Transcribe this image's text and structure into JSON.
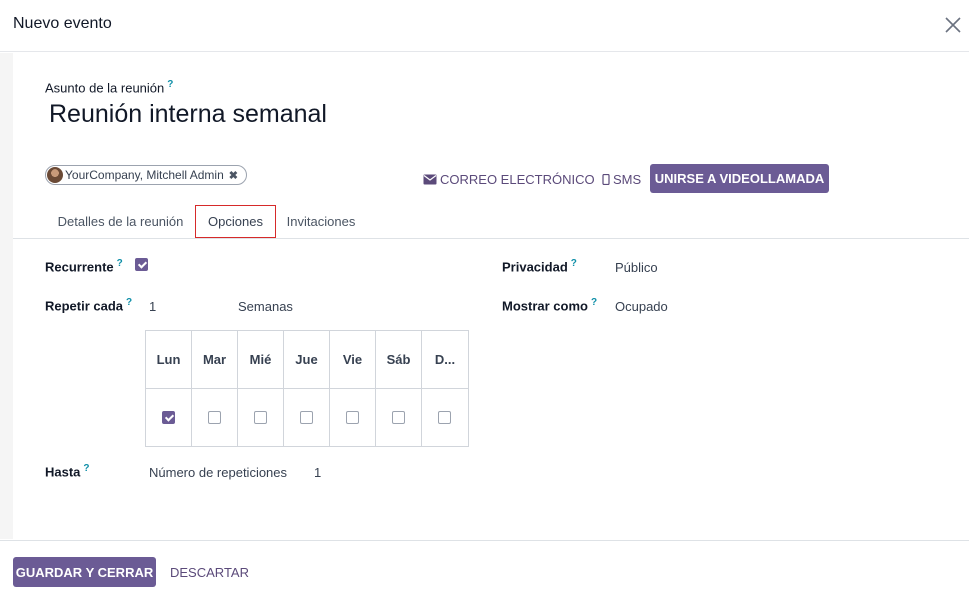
{
  "modal": {
    "title": "Nuevo evento",
    "close_icon": "close-icon"
  },
  "form": {
    "subject_label": "Asunto de la reunión",
    "help_mark": "?",
    "subject_value": "Reunión interna semanal",
    "attendee": {
      "name": "YourCompany, Mitchell Admin",
      "remove_glyph": "✖"
    }
  },
  "actions": {
    "email_label": "CORREO ELECTRÓNICO",
    "email_icon": "envelope-icon",
    "sms_label": "SMS",
    "sms_icon": "mobile-icon",
    "video_label": "UNIRSE A VIDEOLLAMADA"
  },
  "tabs": [
    {
      "label": "Detalles de la reunión",
      "active": false
    },
    {
      "label": "Opciones",
      "active": true
    },
    {
      "label": "Invitaciones",
      "active": false
    }
  ],
  "options": {
    "recurrent_label": "Recurrente",
    "recurrent_checked": true,
    "repeat_label": "Repetir cada",
    "repeat_value": "1",
    "repeat_unit": "Semanas",
    "days": [
      {
        "label": "Lun",
        "checked": true
      },
      {
        "label": "Mar",
        "checked": false
      },
      {
        "label": "Mié",
        "checked": false
      },
      {
        "label": "Jue",
        "checked": false
      },
      {
        "label": "Vie",
        "checked": false
      },
      {
        "label": "Sáb",
        "checked": false
      },
      {
        "label": "D...",
        "checked": false
      }
    ],
    "until_label": "Hasta",
    "until_type": "Número de repeticiones",
    "until_value": "1",
    "privacy_label": "Privacidad",
    "privacy_value": "Público",
    "show_as_label": "Mostrar como",
    "show_as_value": "Ocupado"
  },
  "footer": {
    "save_label": "GUARDAR Y CERRAR",
    "discard_label": "DESCARTAR"
  },
  "colors": {
    "primary": "#6b5b95",
    "help": "#0f8fa8",
    "active_tab_border": "#d62a2a"
  }
}
